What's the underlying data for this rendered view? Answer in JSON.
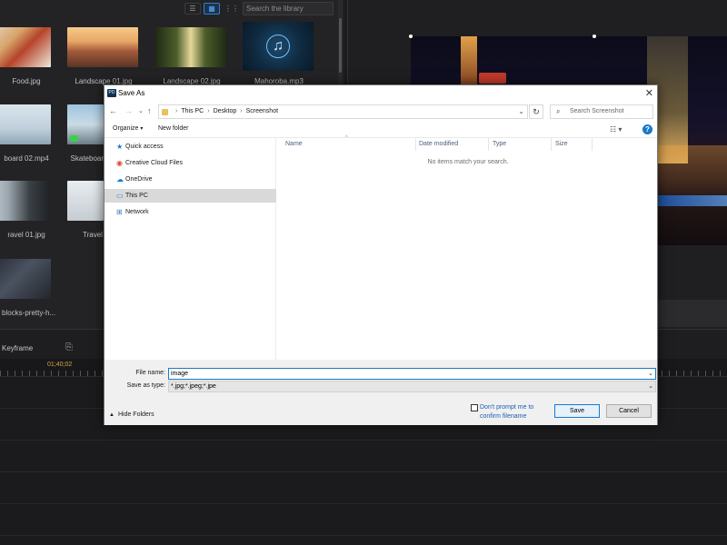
{
  "library": {
    "search_placeholder": "Search the library",
    "thumbnails": [
      {
        "label": "Food.jpg"
      },
      {
        "label": "Landscape 01.jpg"
      },
      {
        "label": "Landscape 02.jpg"
      },
      {
        "label": "Mahoroba.mp3"
      },
      {
        "label": "board 02.mp4"
      },
      {
        "label": "Skateboard"
      },
      {
        "label": "ravel 01.jpg"
      },
      {
        "label": "Travel"
      },
      {
        "label": "blocks-pretty-h..."
      }
    ]
  },
  "timeline": {
    "keyframe_label": "Keyframe",
    "timecode": "01;40;02"
  },
  "dialog": {
    "title": "Save As",
    "breadcrumb": [
      "This PC",
      "Desktop",
      "Screenshot"
    ],
    "search_placeholder": "Search Screenshot",
    "organize_label": "Organize",
    "new_folder_label": "New folder",
    "nav_items": [
      {
        "label": "Quick access",
        "icon": "star-icon"
      },
      {
        "label": "Creative Cloud Files",
        "icon": "creative-cloud-icon"
      },
      {
        "label": "OneDrive",
        "icon": "cloud-icon"
      },
      {
        "label": "This PC",
        "icon": "computer-icon",
        "selected": true
      },
      {
        "label": "Network",
        "icon": "network-icon"
      }
    ],
    "columns": [
      "Name",
      "Date modified",
      "Type",
      "Size"
    ],
    "empty_message": "No items match your search.",
    "file_name_label": "File name:",
    "file_name_value": "image",
    "save_type_label": "Save as type:",
    "save_type_value": "*.jpg;*.jpeg;*.jpe",
    "hide_folders_label": "Hide Folders",
    "dont_prompt_label": "Don't prompt me to confirm filename",
    "save_label": "Save",
    "cancel_label": "Cancel"
  },
  "colors": {
    "accent": "#1979ca",
    "timecode": "#d4a437"
  }
}
